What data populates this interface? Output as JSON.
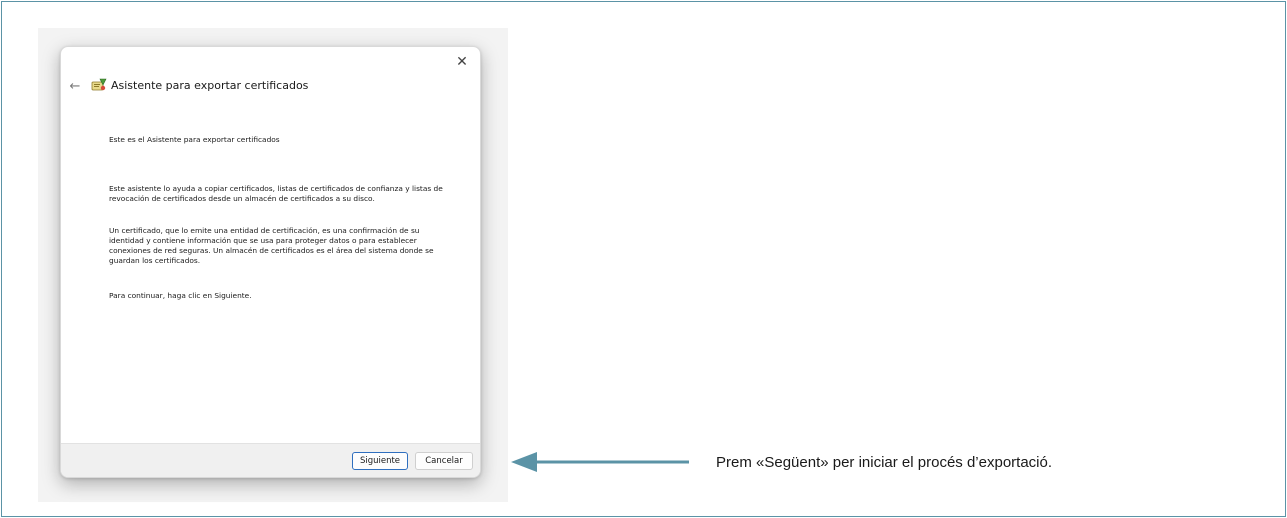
{
  "dialog": {
    "title": "Asistente para exportar certificados",
    "close_glyph": "✕",
    "back_glyph": "←",
    "heading": "Este es el Asistente para exportar certificados",
    "paragraphs": [
      "Este asistente lo ayuda a copiar certificados, listas de certificados de confianza y listas de revocación de certificados desde un almacén de certificados a su disco.",
      "Un certificado, que lo emite una entidad de certificación, es una confirmación de su identidad y contiene información que se usa para proteger datos o para establecer conexiones de red seguras. Un almacén de certificados es el área del sistema donde se guardan los certificados.",
      "Para continuar, haga clic en Siguiente."
    ],
    "buttons": {
      "next_label": "Siguiente",
      "cancel_label": "Cancelar"
    },
    "icons": {
      "back": "back-arrow-icon",
      "close": "close-icon",
      "wizard": "certificate-wizard-icon"
    }
  },
  "annotation": {
    "text": "Prem «Següent» per iniciar el procés d’exportació.",
    "arrow_icon": "left-arrow-icon",
    "arrow_color": "#5b93a6"
  },
  "colors": {
    "frame_border": "#5b93a6",
    "primary_button_border": "#2f6fbf",
    "footer_bg": "#f0f0f0"
  }
}
